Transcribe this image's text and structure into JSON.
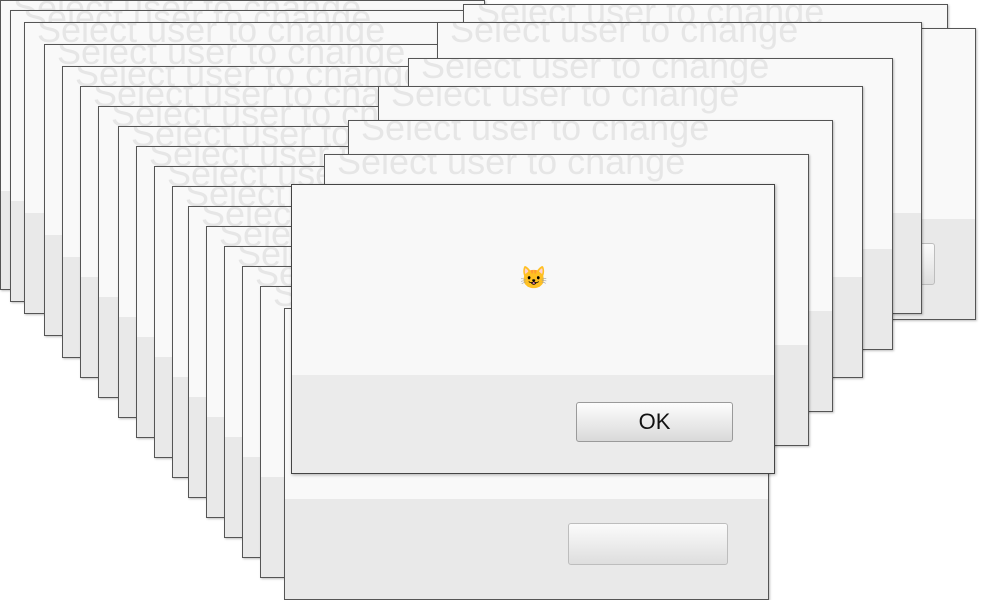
{
  "background_dialogs": {
    "title_text": "Select user to change",
    "count": 22
  },
  "dialog": {
    "message": "😺",
    "message_icon": "smiling-cat-emoji",
    "ok_label": "OK"
  },
  "colors": {
    "dialog_top": "#f8f8f8",
    "dialog_bottom": "#ebebeb",
    "border": "#444444"
  }
}
